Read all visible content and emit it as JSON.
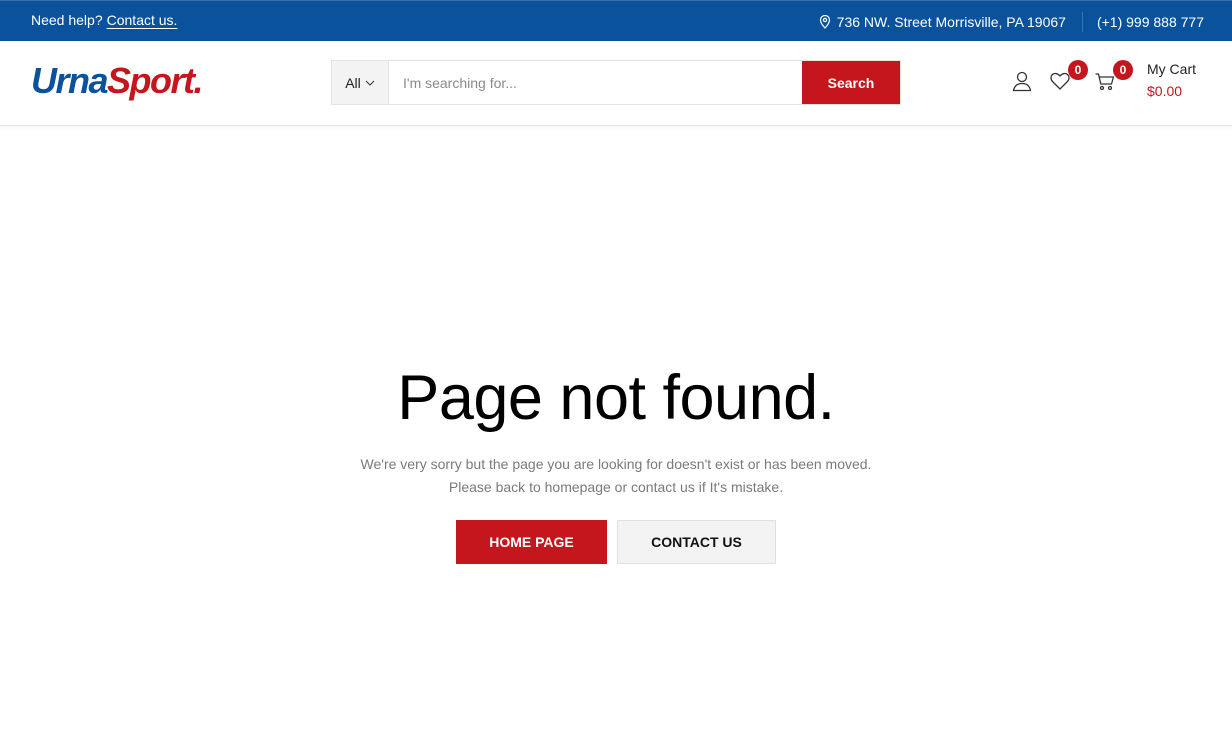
{
  "topbar": {
    "help_text": "Need help?",
    "contact_link": "Contact us.",
    "address": "736 NW. Street Morrisville, PA 19067",
    "phone": "(+1) 999 888 777",
    "location_icon": "map-pin-icon"
  },
  "header": {
    "logo_part1": "Urna",
    "logo_part2": "Sport.",
    "search": {
      "category": "All",
      "placeholder": "I'm searching for...",
      "button": "Search"
    },
    "wishlist_count": "0",
    "cart_count": "0",
    "cart_label": "My Cart",
    "cart_total": "$0.00"
  },
  "main": {
    "title": "Page not found.",
    "message_line1": "We're very sorry but the page you are looking for doesn't exist or has been moved.",
    "message_line2": "Please back to homepage or contact us if It's mistake.",
    "home_button": "HOME PAGE",
    "contact_button": "CONTACT US"
  },
  "colors": {
    "brand_blue": "#0a529c",
    "brand_red": "#c4161c"
  }
}
